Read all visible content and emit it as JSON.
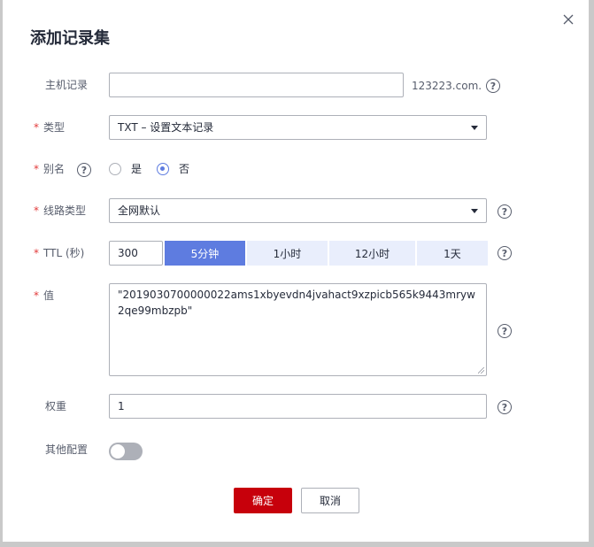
{
  "dialog": {
    "title": "添加记录集"
  },
  "host_record": {
    "label": "主机记录",
    "value": "",
    "suffix": "123223.com.",
    "help": "?"
  },
  "type": {
    "required": "*",
    "label": "类型",
    "value": "TXT – 设置文本记录"
  },
  "alias": {
    "required": "*",
    "label": "别名",
    "help": "?",
    "options": [
      {
        "label": "是",
        "checked": false
      },
      {
        "label": "否",
        "checked": true
      }
    ]
  },
  "line_type": {
    "required": "*",
    "label": "线路类型",
    "value": "全网默认",
    "help": "?"
  },
  "ttl": {
    "required": "*",
    "label": "TTL (秒)",
    "value": "300",
    "presets": [
      "5分钟",
      "1小时",
      "12小时",
      "1天"
    ],
    "active_preset": "5分钟",
    "help": "?"
  },
  "value": {
    "required": "*",
    "label": "值",
    "text": "\"2019030700000022ams1xbyevdn4jvahact9xzpicb565k9443mryw2qe99mbzpb\"",
    "help": "?"
  },
  "weight": {
    "label": "权重",
    "value": "1",
    "help": "?"
  },
  "other_config": {
    "label": "其他配置",
    "enabled": false
  },
  "footer": {
    "confirm_label": "确定",
    "cancel_label": "取消"
  },
  "colors": {
    "brand_red": "#c7000b",
    "accent_blue": "#5e7ce0",
    "segment_bg": "#e9eefc"
  },
  "icons": {
    "close": "close-icon",
    "help": "help-icon",
    "dropdown": "chevron-down-icon"
  }
}
